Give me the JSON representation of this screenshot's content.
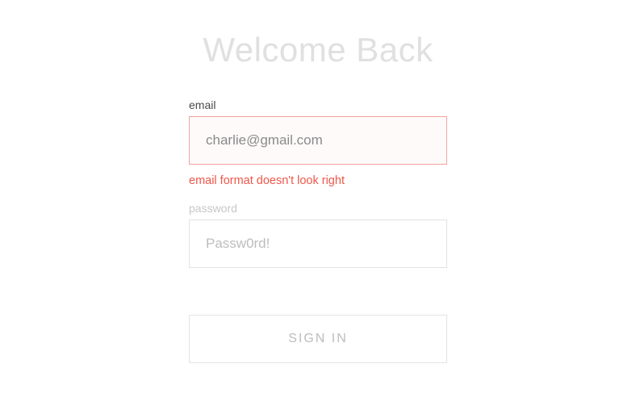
{
  "heading": "Welcome Back",
  "form": {
    "email": {
      "label": "email",
      "value": "charlie@gmail.com",
      "error": "email format doesn't look right"
    },
    "password": {
      "label": "password",
      "placeholder": "Passw0rd!"
    },
    "submit": {
      "label": "SIGN IN"
    }
  }
}
